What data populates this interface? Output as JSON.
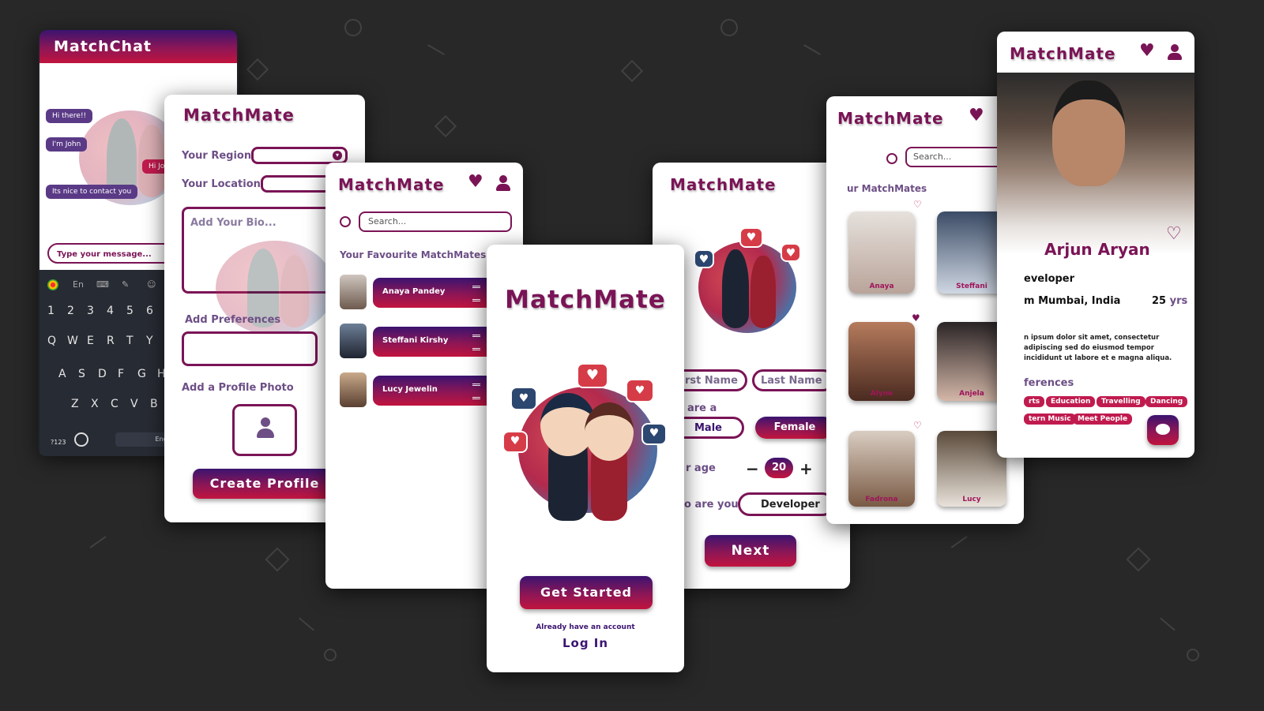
{
  "chat": {
    "title": "MatchChat",
    "messages": [
      "Hi there!!",
      "I'm John",
      "Hi Jo",
      "Its nice to contact you"
    ],
    "input_placeholder": "Type your message...",
    "keyboard": {
      "toolbar": [
        "En",
        "⌨",
        "✎",
        "☺"
      ],
      "row1": [
        "1",
        "2",
        "3",
        "4",
        "5",
        "6"
      ],
      "row2": [
        "Q",
        "W",
        "E",
        "R",
        "T",
        "Y"
      ],
      "row3": [
        "A",
        "S",
        "D",
        "F",
        "G",
        "H"
      ],
      "row4": [
        "Z",
        "X",
        "C",
        "V",
        "B"
      ],
      "bottom": [
        "?123",
        "English"
      ]
    }
  },
  "create_profile": {
    "brand": "MatchMate",
    "region_label": "Your Region",
    "location_label": "Your Location",
    "bio_placeholder": "Add Your Bio...",
    "preferences_label": "Add Preferences",
    "photo_label": "Add a Profile Photo",
    "create_button": "Create Profile"
  },
  "favourites": {
    "brand": "MatchMate",
    "search_placeholder": "Search...",
    "section_title": "Your Favourite MatchMates",
    "items": [
      "Anaya Pandey",
      "Steffani Kirshy",
      "Lucy Jewelin"
    ]
  },
  "welcome": {
    "brand": "MatchMate",
    "get_started": "Get Started",
    "already": "Already have an account",
    "login": "Log In"
  },
  "details": {
    "brand": "MatchMate",
    "first_name": "rst Name",
    "last_name": "Last Name",
    "gender_label": "are a",
    "male": "Male",
    "female": "Female",
    "age_label": "r age",
    "age_value": "20",
    "minus": "−",
    "plus": "+",
    "role_label": "o are you",
    "role_value": "Developer",
    "next": "Next"
  },
  "browse": {
    "brand": "MatchMate",
    "search_placeholder": "Search...",
    "section_title": "ur MatchMates",
    "cards": [
      "Anaya",
      "Steffani",
      "Alyne",
      "Anjela",
      "Fadrona",
      "Lucy"
    ]
  },
  "profile": {
    "brand": "MatchMate",
    "name": "Arjun Aryan",
    "role": "eveloper",
    "location": "m Mumbai, India",
    "age": "25",
    "age_unit": "yrs",
    "bio": "n ipsum dolor sit amet, consectetur adipiscing sed do eiusmod tempor incididunt ut labore et e magna aliqua.",
    "pref_title": "ferences",
    "chips_row1": [
      "rts",
      "Education",
      "Travelling",
      "Dancing"
    ],
    "chips_row2": [
      "tern Music",
      "Meet People"
    ]
  },
  "colors": {
    "brand": "#7a1456",
    "background": "#282828",
    "accent": "#c2143e",
    "deep": "#3b1470"
  }
}
